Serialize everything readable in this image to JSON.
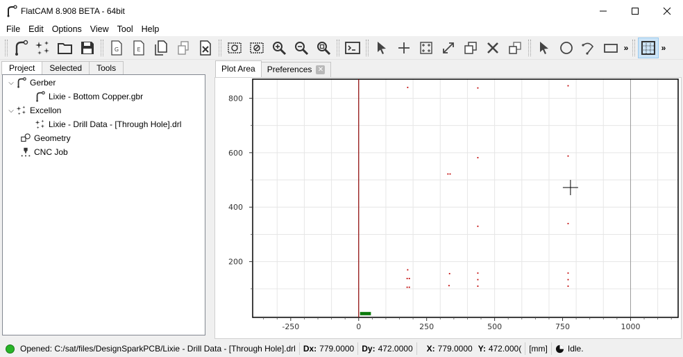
{
  "window": {
    "title": "FlatCAM 8.908 BETA - 64bit",
    "controls": [
      "minimize",
      "maximize",
      "close"
    ]
  },
  "menu": {
    "items": [
      "File",
      "Edit",
      "Options",
      "View",
      "Tool",
      "Help"
    ]
  },
  "toolbar": {
    "buttons": [
      "open-gerber-icon",
      "open-excellon-icon",
      "open-folder-icon",
      "save-icon",
      "new-gcode-icon",
      "new-excellon-doc-icon",
      "copy-object-icon",
      "duplicate-object-icon",
      "delete-object-icon",
      "replot-icon",
      "clear-plot-icon",
      "zoom-in-icon",
      "zoom-out-icon",
      "zoom-fit-icon",
      "shell-icon",
      "select-icon",
      "add-drill-icon",
      "array-icon",
      "resize-icon",
      "copy-icon",
      "delete-icon",
      "move-icon",
      "select-icon",
      "circle-icon",
      "arc-icon",
      "rectangle-icon",
      "snap-grid-icon"
    ],
    "overflow_label": "»"
  },
  "left_panel": {
    "tabs": [
      {
        "label": "Project",
        "active": true
      },
      {
        "label": "Selected",
        "active": false
      },
      {
        "label": "Tools",
        "active": false
      }
    ],
    "tree": {
      "gerber_label": "Gerber",
      "gerber_child": "Lixie - Bottom Copper.gbr",
      "excellon_label": "Excellon",
      "excellon_child": "Lixie - Drill Data - [Through Hole].drl",
      "geometry_label": "Geometry",
      "cnc_label": "CNC Job"
    }
  },
  "right_panel": {
    "tabs": [
      {
        "label": "Plot Area",
        "active": true
      },
      {
        "label": "Preferences",
        "active": false,
        "closable": true
      }
    ]
  },
  "chart_data": {
    "type": "scatter",
    "title": "",
    "xlabel": "",
    "ylabel": "",
    "xlim": [
      -390,
      1175
    ],
    "ylim": [
      -5,
      870
    ],
    "x_ticks": [
      -250,
      0,
      250,
      500,
      750,
      1000
    ],
    "y_ticks": [
      200,
      400,
      600,
      800
    ],
    "grid": true,
    "grid_step": 100,
    "axis_color": "#8b0000",
    "point_color": "#c00000",
    "board_color": "#0b7a0b",
    "board": {
      "x0": 5,
      "x1": 45,
      "y0": 3,
      "y1": 15
    },
    "cursor": {
      "x": 779,
      "y": 472
    },
    "points": [
      [
        180,
        840
      ],
      [
        438,
        838
      ],
      [
        770,
        846
      ],
      [
        438,
        582
      ],
      [
        770,
        588
      ],
      [
        328,
        522
      ],
      [
        336,
        522
      ],
      [
        438,
        330
      ],
      [
        770,
        340
      ],
      [
        180,
        170
      ],
      [
        178,
        138
      ],
      [
        186,
        138
      ],
      [
        178,
        106
      ],
      [
        186,
        106
      ],
      [
        334,
        156
      ],
      [
        332,
        112
      ],
      [
        438,
        158
      ],
      [
        438,
        134
      ],
      [
        438,
        110
      ],
      [
        770,
        158
      ],
      [
        770,
        134
      ],
      [
        770,
        110
      ]
    ]
  },
  "status": {
    "indicator_color": "#27b427",
    "message": "Opened: C:/sat/files/DesignSparkPCB/Lixie - Drill Data - [Through Hole].drl",
    "dx_label": "Dx:",
    "dx_value": "779.0000",
    "dy_label": "Dy:",
    "dy_value": "472.0000",
    "x_label": "X:",
    "x_value": "779.0000",
    "y_label": "Y:",
    "y_value": "472.000(",
    "units": "[mm]",
    "state": "Idle."
  }
}
